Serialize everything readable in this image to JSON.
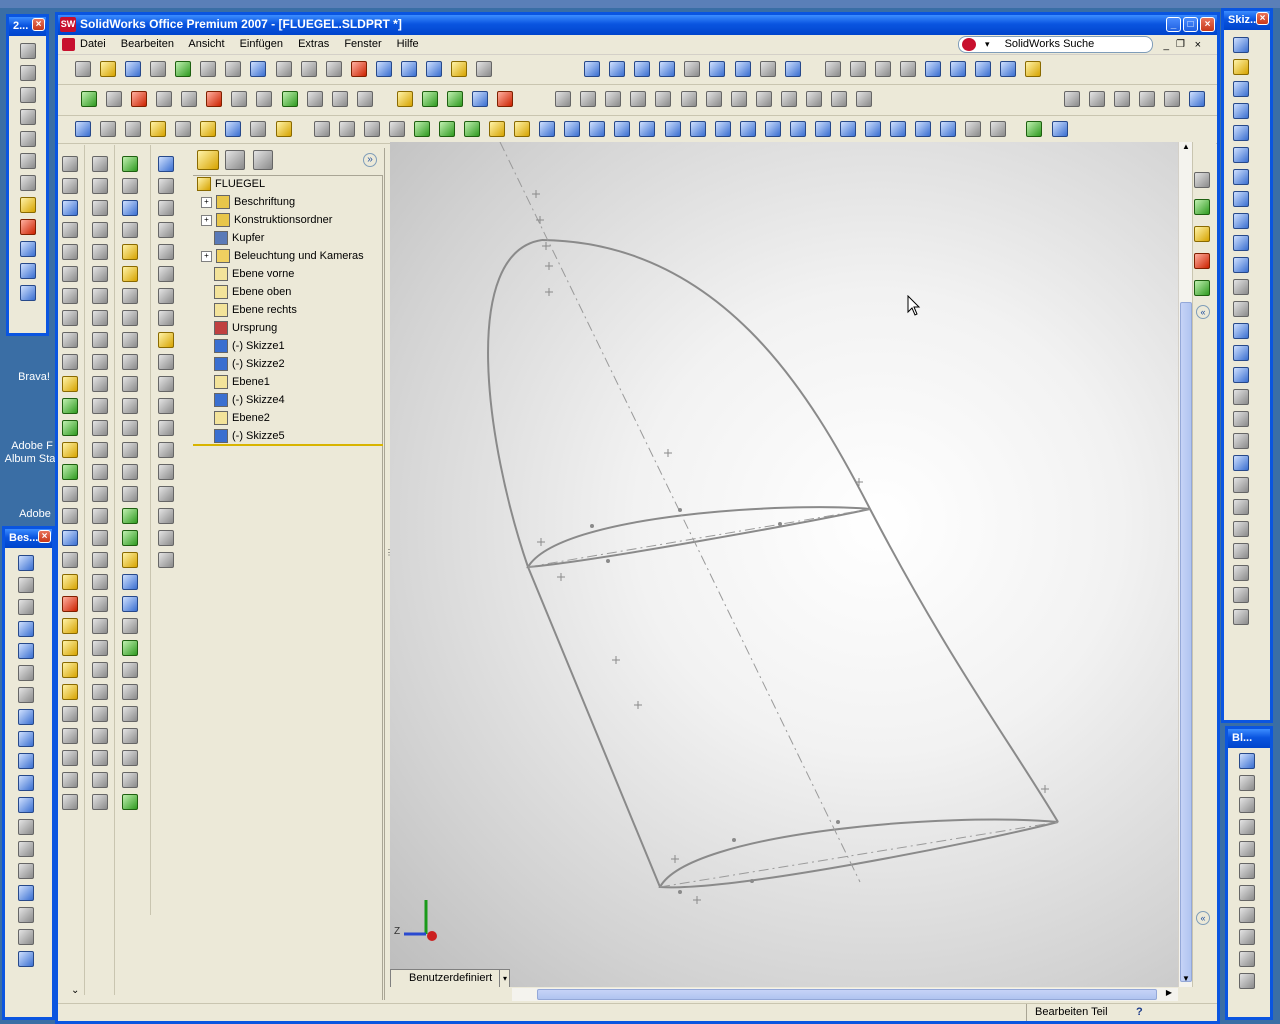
{
  "window": {
    "title": "SolidWorks Office Premium 2007 - [FLUEGEL.SLDPRT *]"
  },
  "menu": [
    "Datei",
    "Bearbeiten",
    "Ansicht",
    "Einfügen",
    "Extras",
    "Fenster",
    "Hilfe"
  ],
  "search": {
    "label": "SolidWorks Suche"
  },
  "palettes": {
    "top_left_title": "2...",
    "bottom_left_title": "Bes...",
    "right_title": "Skiz...",
    "right_bottom_title": "Bl..."
  },
  "desktop_icons": [
    "Brava!",
    "Adobe F",
    "Album Sta",
    "Adobe"
  ],
  "tree": {
    "root": "FLUEGEL",
    "items": [
      {
        "label": "Beschriftung",
        "expandable": true,
        "icon": "annotation-icon"
      },
      {
        "label": "Konstruktionsordner",
        "expandable": true,
        "icon": "design-folder-icon"
      },
      {
        "label": "Kupfer",
        "expandable": false,
        "icon": "material-icon"
      },
      {
        "label": "Beleuchtung und Kameras",
        "expandable": true,
        "icon": "lights-icon"
      },
      {
        "label": "Ebene vorne",
        "expandable": false,
        "icon": "plane-icon"
      },
      {
        "label": "Ebene oben",
        "expandable": false,
        "icon": "plane-icon"
      },
      {
        "label": "Ebene rechts",
        "expandable": false,
        "icon": "plane-icon"
      },
      {
        "label": "Ursprung",
        "expandable": false,
        "icon": "origin-icon"
      },
      {
        "label": "(-) Skizze1",
        "expandable": false,
        "icon": "sketch-icon"
      },
      {
        "label": "(-) Skizze2",
        "expandable": false,
        "icon": "sketch-icon"
      },
      {
        "label": "Ebene1",
        "expandable": false,
        "icon": "plane-icon"
      },
      {
        "label": "(-) Skizze4",
        "expandable": false,
        "icon": "sketch-icon"
      },
      {
        "label": "Ebene2",
        "expandable": false,
        "icon": "plane-icon"
      },
      {
        "label": "(-) Skizze5",
        "expandable": false,
        "icon": "sketch-icon"
      }
    ]
  },
  "viewport": {
    "view_tab": "Benutzerdefiniert",
    "triad_label": "Z"
  },
  "status": {
    "mode": "Bearbeiten Teil",
    "help": "?"
  },
  "colors": {
    "title_bar": "#0a55e0",
    "panel_bg": "#ece9d8",
    "sketch_line": "#808080"
  }
}
